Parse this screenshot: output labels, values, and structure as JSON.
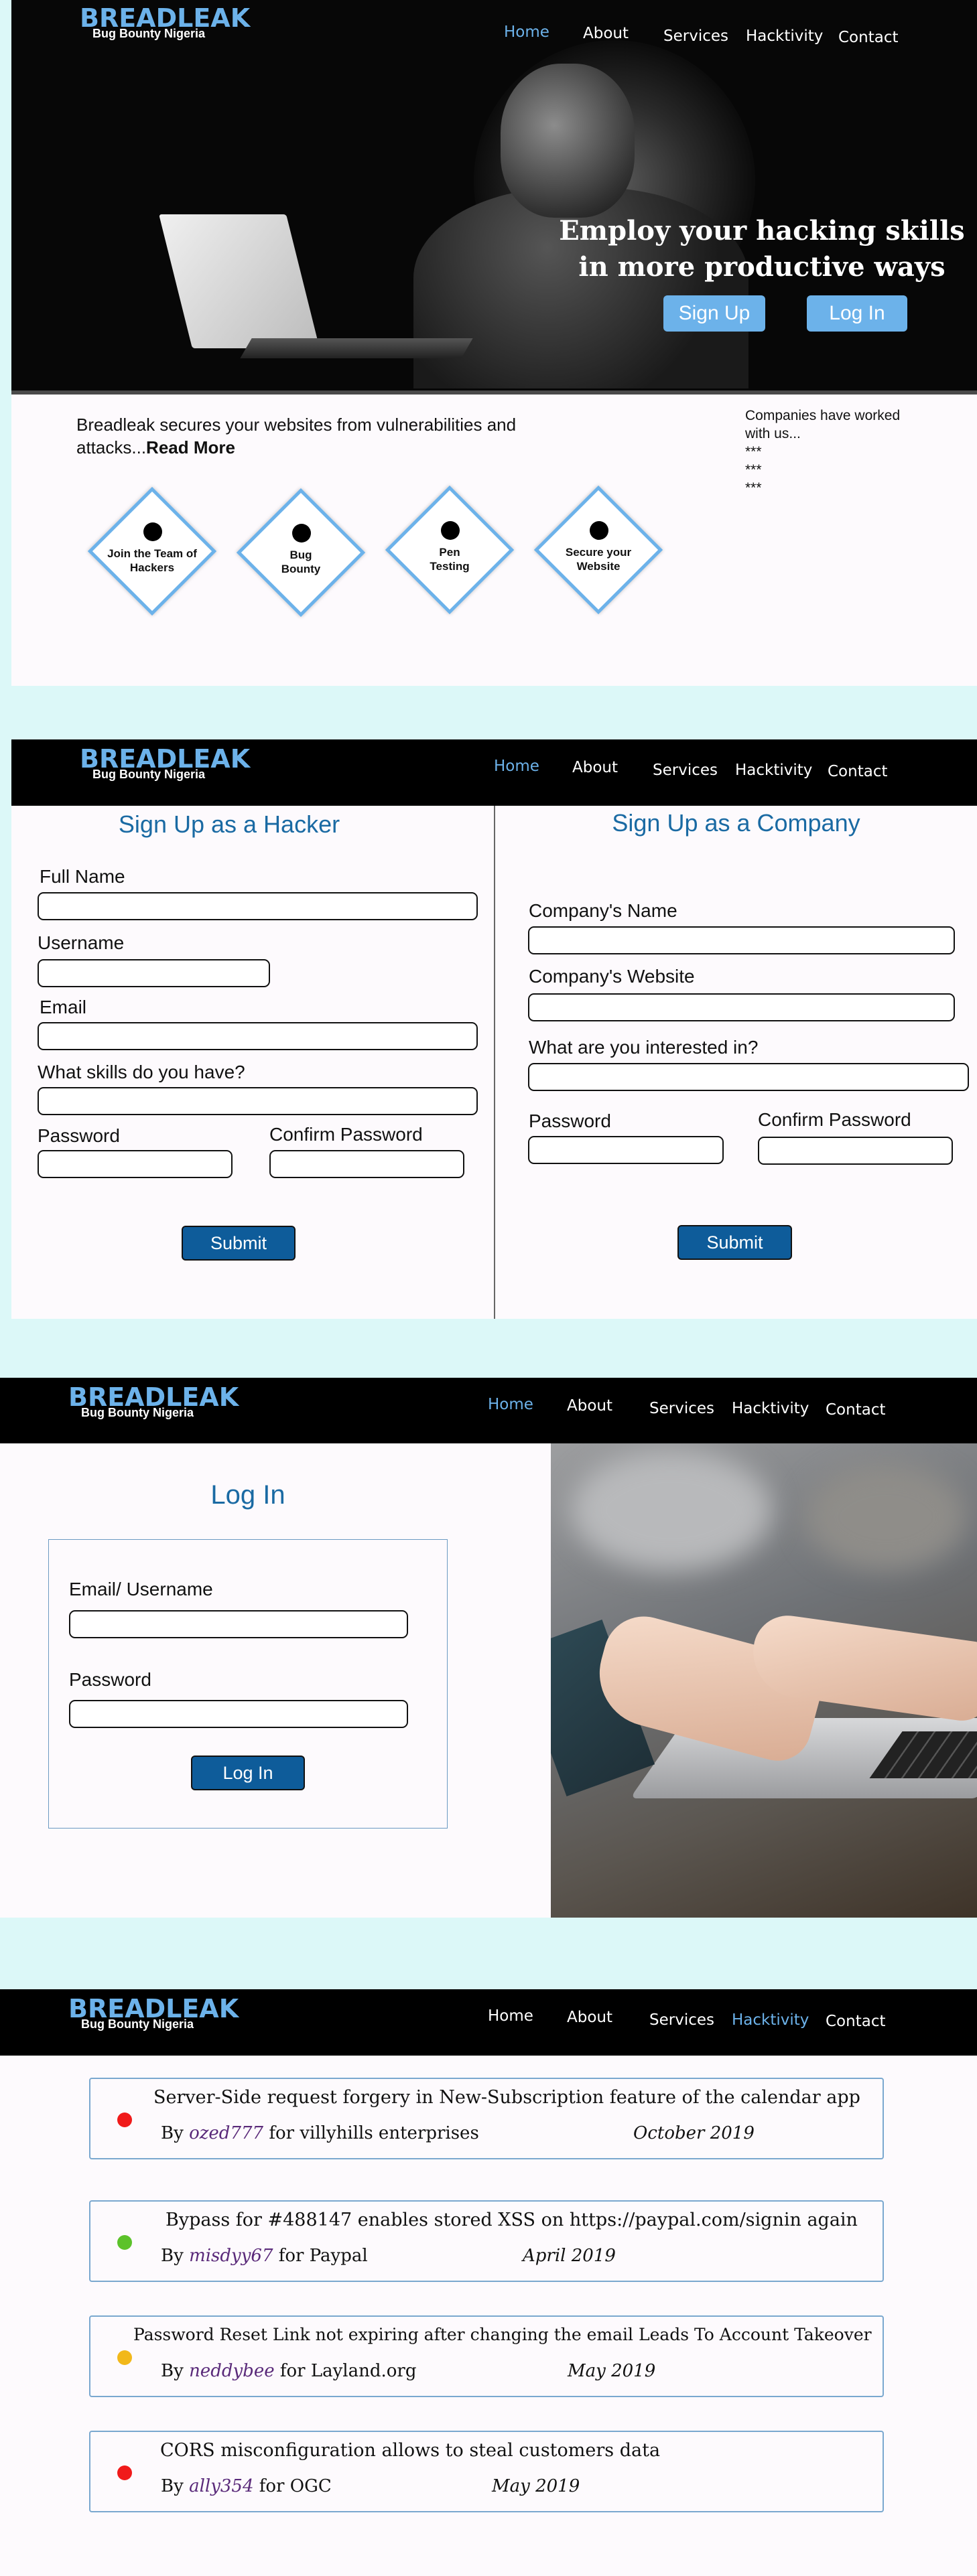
{
  "brand": {
    "name": "BREADLEAK",
    "tagline": "Bug Bounty Nigeria"
  },
  "nav": {
    "home": "Home",
    "about": "About",
    "services": "Services",
    "hacktivity": "Hacktivity",
    "contact": "Contact"
  },
  "hero": {
    "title_line1": "Employ your hacking skills",
    "title_line2": "in more productive ways",
    "signup_label": "Sign Up",
    "login_label": "Log In"
  },
  "intro": {
    "text": "Breadleak secures your websites from vulnerabilities and attacks...",
    "read_more": "Read More",
    "companies_title": "Companies have worked with us...",
    "companies": [
      "***",
      "***",
      "***"
    ],
    "services": [
      {
        "label": "Join the Team of Hackers"
      },
      {
        "label": "Bug Bounty"
      },
      {
        "label": "Pen Testing"
      },
      {
        "label": "Secure your Website"
      }
    ]
  },
  "signup": {
    "hacker_title": "Sign Up as a Hacker",
    "company_title": "Sign Up as a Company",
    "hacker_fields": {
      "full_name": "Full Name",
      "username": "Username",
      "email": "Email",
      "skills": "What skills do you have?",
      "password": "Password",
      "confirm_password": "Confirm Password"
    },
    "company_fields": {
      "name": "Company's Name",
      "website": "Company's Website",
      "interest": "What are you interested in?",
      "password": "Password",
      "confirm_password": "Confirm Password"
    },
    "submit_label": "Submit"
  },
  "login": {
    "title": "Log In",
    "email_label": "Email/ Username",
    "password_label": "Password",
    "button_label": "Log In"
  },
  "hacktivity": {
    "colors": {
      "red": "#f01a1a",
      "green": "#5cc22a",
      "yellow": "#f2b81a"
    },
    "items": [
      {
        "title": "Server-Side request forgery in New-Subscription feature of the calendar app",
        "by": "By",
        "user": "ozed777",
        "for": "for villyhills enterprises",
        "date": "October 2019",
        "status": "red"
      },
      {
        "title": "Bypass for #488147 enables stored XSS on https://paypal.com/signin again",
        "by": "By",
        "user": "misdyy67",
        "for": "for Paypal",
        "date": "April 2019",
        "status": "green"
      },
      {
        "title": "Password Reset Link not expiring after changing the email Leads To Account Takeover",
        "by": "By",
        "user": "neddybee",
        "for": "for Layland.org",
        "date": "May 2019",
        "status": "yellow"
      },
      {
        "title": "CORS misconfiguration allows to steal customers data",
        "by": "By",
        "user": "ally354",
        "for": "for OGC",
        "date": "May 2019",
        "status": "red"
      }
    ]
  }
}
